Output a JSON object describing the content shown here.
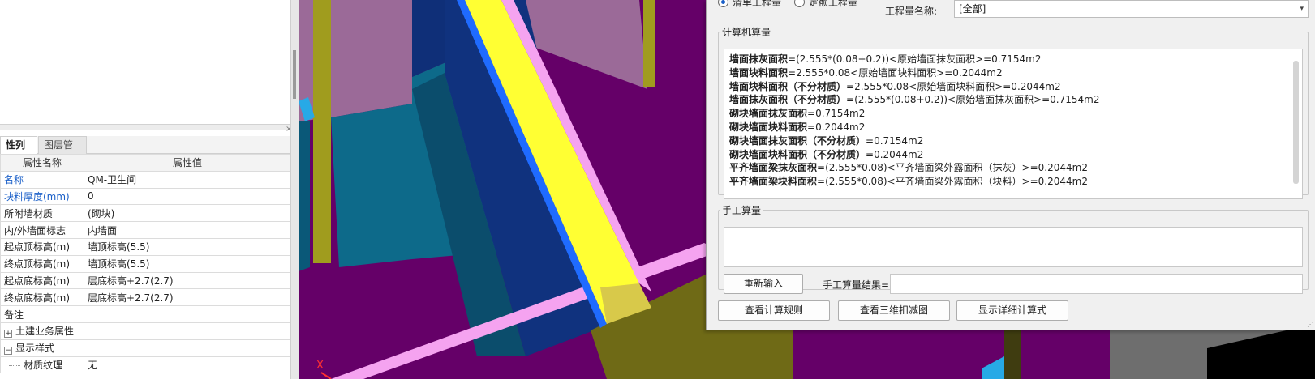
{
  "radio_options": [
    {
      "label": "清单工程量",
      "selected": true
    },
    {
      "label": "定额工程量",
      "selected": false
    }
  ],
  "quantity_name": {
    "label": "工程量名称:",
    "value": "[全部]"
  },
  "computer_calc": {
    "legend": "计算机算量",
    "lines": [
      {
        "name": "墙面抹灰面积",
        "expr": "=(2.555*(0.08+0.2))<原始墙面抹灰面积>=0.7154m2"
      },
      {
        "name": "墙面块料面积",
        "expr": "=2.555*0.08<原始墙面块料面积>=0.2044m2"
      },
      {
        "name": "墙面块料面积（不分材质）",
        "expr": "=2.555*0.08<原始墙面块料面积>=0.2044m2"
      },
      {
        "name": "墙面抹灰面积（不分材质）",
        "expr": "=(2.555*(0.08+0.2))<原始墙面抹灰面积>=0.7154m2"
      },
      {
        "name": "砌块墙面抹灰面积",
        "expr": "=0.7154m2"
      },
      {
        "name": "砌块墙面块料面积",
        "expr": "=0.2044m2"
      },
      {
        "name": "砌块墙面抹灰面积（不分材质）",
        "expr": "=0.7154m2"
      },
      {
        "name": "砌块墙面块料面积（不分材质）",
        "expr": "=0.2044m2"
      },
      {
        "name": "平齐墙面梁抹灰面积",
        "expr": "=(2.555*0.08)<平齐墙面梁外露面积（抹灰）>=0.2044m2"
      },
      {
        "name": "平齐墙面梁块料面积",
        "expr": "=(2.555*0.08)<平齐墙面梁外露面积（块料）>=0.2044m2"
      }
    ]
  },
  "manual_calc": {
    "legend": "手工算量",
    "reinput_button": "重新输入",
    "result_label": "手工算量结果=",
    "result_value": ""
  },
  "bottom_buttons": {
    "rules": "查看计算规则",
    "view3d": "查看三维扣减图",
    "detail": "显示详细计算式"
  },
  "left_panel": {
    "tabs": [
      "性列表",
      "图层管理"
    ],
    "close_label": "×",
    "header": {
      "name": "属性名称",
      "value": "属性值"
    },
    "rows": [
      {
        "name": "名称",
        "value": "QM-卫生间",
        "blue": true
      },
      {
        "name": "块料厚度(mm)",
        "value": "0",
        "blue": true
      },
      {
        "name": "所附墙材质",
        "value": "(砌块)"
      },
      {
        "name": "内/外墙面标志",
        "value": "内墙面"
      },
      {
        "name": "起点顶标高(m)",
        "value": "墙顶标高(5.5)"
      },
      {
        "name": "终点顶标高(m)",
        "value": "墙顶标高(5.5)"
      },
      {
        "name": "起点底标高(m)",
        "value": "层底标高+2.7(2.7)"
      },
      {
        "name": "终点底标高(m)",
        "value": "层底标高+2.7(2.7)"
      },
      {
        "name": "备注",
        "value": ""
      }
    ],
    "groups": {
      "civil": {
        "expander": "+",
        "label": "土建业务属性"
      },
      "display": {
        "expander": "−",
        "label": "显示样式"
      }
    },
    "material_row": {
      "name": "材质纹理",
      "value": "无"
    }
  },
  "viewport": {
    "axis_label": "X",
    "colors": {
      "purple_floor": "#650068",
      "yellow_beam": "#ffff33",
      "blue_edge": "#1f6bff",
      "pink_edge": "#f5a3f0",
      "navy_wall": "#10327e",
      "teal_wall": "#0d6a8a",
      "olive": "#a09c1e",
      "mauve": "#9b6a98"
    }
  }
}
